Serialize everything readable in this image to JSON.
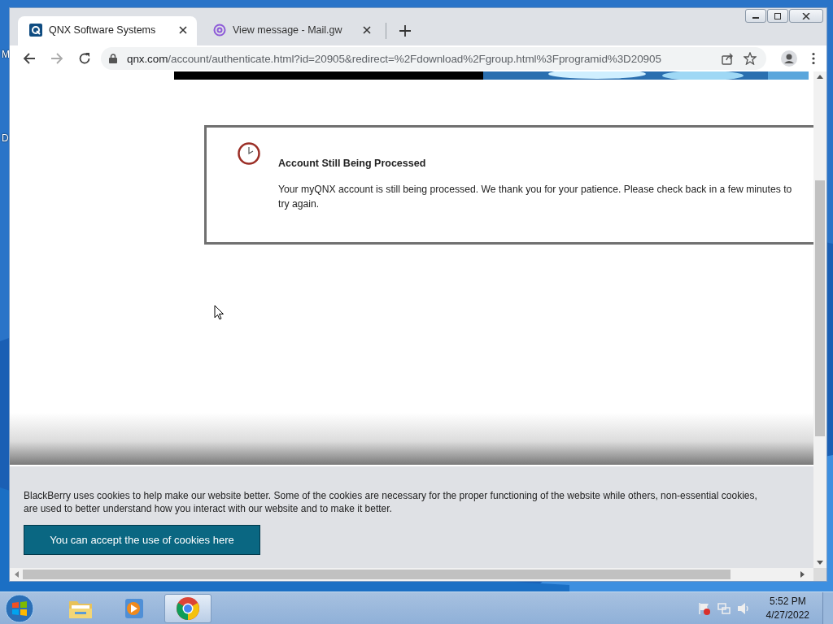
{
  "desktop": {
    "icon_labels": [
      "M",
      "D"
    ]
  },
  "browser": {
    "tabs": [
      {
        "title": "QNX Software Systems",
        "selected": true,
        "kind": "site"
      },
      {
        "title": "View message - Mail.gw",
        "selected": false,
        "kind": "mail"
      }
    ],
    "address": {
      "host": "qnx.com",
      "path": "/account/authenticate.html?id=20905&redirect=%2Fdownload%2Fgroup.html%3Fprogramid%3D20905"
    }
  },
  "notice": {
    "title": "Account Still Being Processed",
    "message": "Your myQNX account is still being processed. We thank you for your patience. Please check back in a few minutes to try again."
  },
  "cookie_banner": {
    "text": "BlackBerry uses cookies to help make our website better. Some of the cookies are necessary for the proper functioning of the website while others, non-essential cookies, are used to better understand how you interact with our website and to make it better.",
    "button": "You can accept the use of cookies here"
  },
  "taskbar": {
    "apps": [
      {
        "kind": "folder",
        "selected": false
      },
      {
        "kind": "media",
        "selected": false
      },
      {
        "kind": "browser",
        "selected": true
      }
    ],
    "time": "5:52 PM",
    "date": "4/27/2022"
  }
}
